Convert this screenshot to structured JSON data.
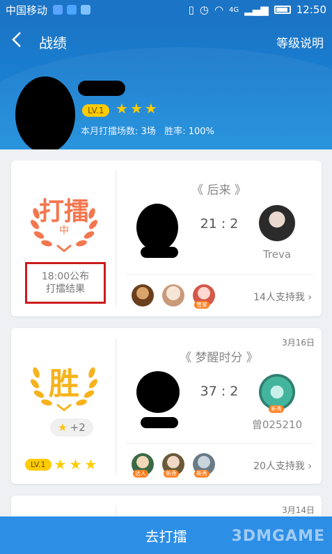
{
  "status_bar": {
    "carrier": "中国移动",
    "network": "4G",
    "time": "12:50"
  },
  "header": {
    "back_icon": "chevron-left-icon",
    "title": "战绩",
    "level_help": "等级说明",
    "level_badge": "LV.1",
    "stars": 3,
    "stats_prefix": "本月打擂场数: ",
    "stats_count": "3场",
    "stats_winrate_label": "胜率: ",
    "stats_winrate": "100%"
  },
  "cards": [
    {
      "emblem_text": "打擂",
      "emblem_sub": "中",
      "publish_time": "18:00公布",
      "publish_text": "打擂结果",
      "match_name": "《 后来 》",
      "score": "21 : 2",
      "opponent_name": "Treva",
      "supporter_tag": "管家",
      "support_text": "14人支持我",
      "chevron_icon": "chevron-right-icon"
    },
    {
      "date": "3月16日",
      "emblem_text": "胜",
      "bonus": "+2",
      "level_badge": "LV.1",
      "match_name": "《 梦醒时分 》",
      "score": "37 : 2",
      "opponent_tag": "新秀",
      "opponent_name": "曾025210",
      "supporter_tags": [
        "达人",
        "新秀",
        "新秀"
      ],
      "support_text": "20人支持我",
      "chevron_icon": "chevron-right-icon"
    },
    {
      "date": "3月14日"
    }
  ],
  "bottom_bar": {
    "label": "去打擂",
    "watermark": "3DMGAME"
  },
  "colors": {
    "brand_blue": "#1b74c5",
    "accent_orange": "#f4764e",
    "winner_gold": "#f7b21c",
    "star_yellow": "#ffcc00",
    "bottom_blue": "#2d8ee6"
  }
}
